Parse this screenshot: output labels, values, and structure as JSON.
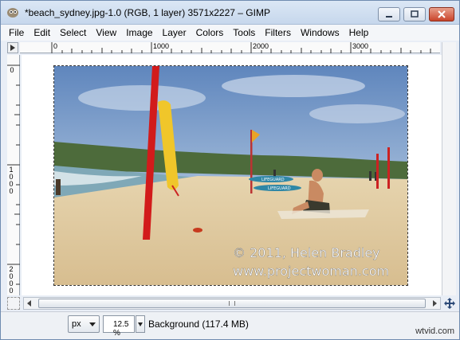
{
  "window": {
    "title": "*beach_sydney.jpg-1.0 (RGB, 1 layer) 3571x2227 – GIMP",
    "app_icon": "gimp-icon"
  },
  "menu": {
    "items": [
      "File",
      "Edit",
      "Select",
      "View",
      "Image",
      "Layer",
      "Colors",
      "Tools",
      "Filters",
      "Windows",
      "Help"
    ]
  },
  "hruler": {
    "labels": [
      "0",
      "1000",
      "2000",
      "3000"
    ]
  },
  "vruler": {
    "label_0": "0",
    "label_1000": "1000",
    "label_2000": "2000"
  },
  "photo": {
    "line1": "© 2011, Helen Bradley",
    "line2": "www.projectwoman.com",
    "board_text": "LIFEGUARD"
  },
  "statusbar": {
    "units": "px",
    "zoom": "12.5 %",
    "info": "Background (117.4 MB)",
    "watermark": "wtvid.com"
  },
  "colors": {
    "accent": "#c6d7ec",
    "close": "#c9442a"
  }
}
